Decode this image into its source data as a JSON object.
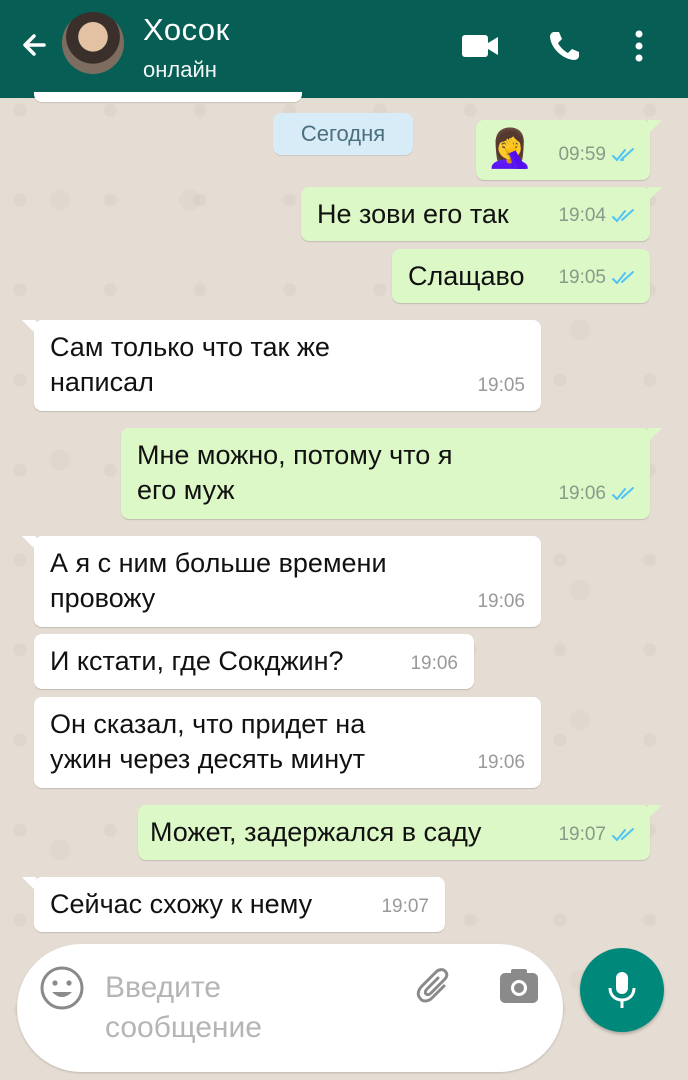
{
  "header": {
    "title": "Хосок",
    "status": "онлайн"
  },
  "chat": {
    "date_divider": "Сегодня",
    "messages": [
      {
        "direction": "out",
        "type": "emoji",
        "emoji": "🤦‍♀️",
        "time": "09:59",
        "read": true
      },
      {
        "direction": "out",
        "text": "Не зови его так",
        "time": "19:04",
        "read": true
      },
      {
        "direction": "out",
        "text": "Слащаво",
        "time": "19:05",
        "read": true
      },
      {
        "direction": "in",
        "text_line1": "Сам только что так же",
        "text_line2": "написал",
        "time": "19:05"
      },
      {
        "direction": "out",
        "text_line1": "Мне можно, потому что я",
        "text_line2": "его муж",
        "time": "19:06",
        "read": true
      },
      {
        "direction": "in",
        "text_line1": "А я с ним больше времени",
        "text_line2": "провожу",
        "time": "19:06"
      },
      {
        "direction": "in",
        "text": "И кстати, где Сокджин?",
        "time": "19:06"
      },
      {
        "direction": "in",
        "text_line1": "Он сказал, что придет на",
        "text_line2": "ужин через десять минут",
        "time": "19:06"
      },
      {
        "direction": "out",
        "text": "Может, задержался в саду",
        "time": "19:07",
        "read": true
      },
      {
        "direction": "in",
        "text": "Сейчас схожу к нему",
        "time": "19:07"
      }
    ]
  },
  "composer": {
    "placeholder_line1": "Введите",
    "placeholder_line2": "сообщение"
  },
  "icons": {
    "back": "arrow-left-icon",
    "video": "video-call-icon",
    "call": "phone-icon",
    "more": "more-vertical-icon",
    "emoji": "emoji-icon",
    "attach": "paperclip-icon",
    "camera": "camera-icon",
    "mic": "microphone-icon"
  },
  "colors": {
    "header": "#075e54",
    "outgoing_bubble": "#dcf8c6",
    "incoming_bubble": "#ffffff",
    "read_ticks": "#4fc3f7",
    "mic_button": "#00897b"
  }
}
